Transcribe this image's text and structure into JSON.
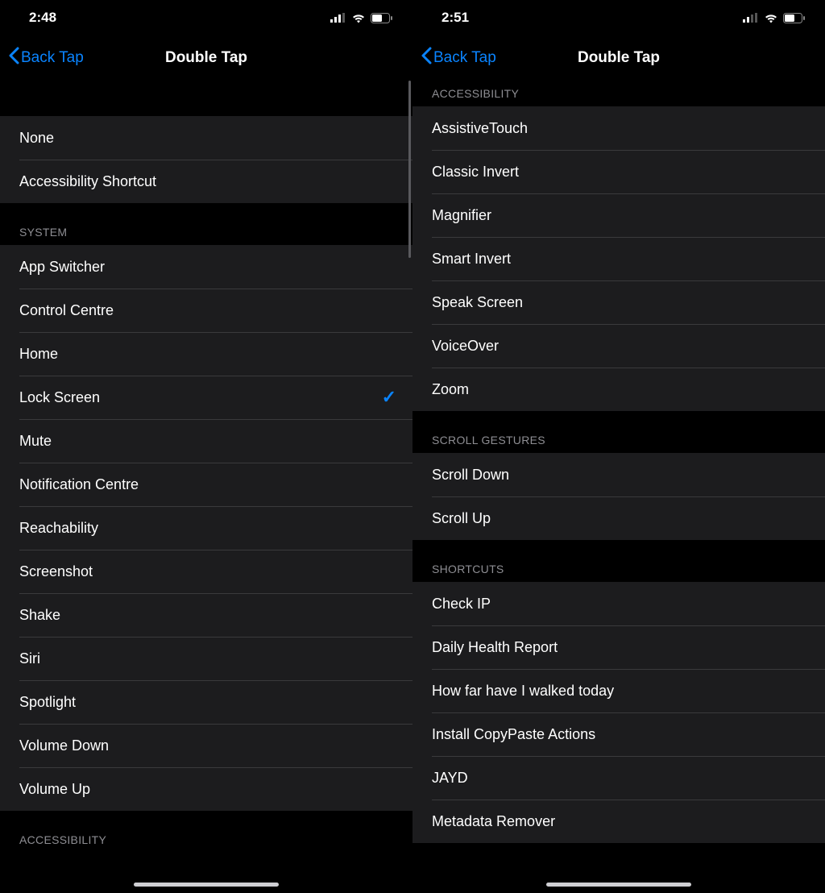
{
  "left": {
    "status": {
      "time": "2:48"
    },
    "nav": {
      "back_label": "Back Tap",
      "title": "Double Tap"
    },
    "top_group": [
      {
        "label": "None",
        "selected": false
      },
      {
        "label": "Accessibility Shortcut",
        "selected": false
      }
    ],
    "sections": [
      {
        "header": "SYSTEM",
        "rows": [
          {
            "label": "App Switcher",
            "selected": false
          },
          {
            "label": "Control Centre",
            "selected": false
          },
          {
            "label": "Home",
            "selected": false
          },
          {
            "label": "Lock Screen",
            "selected": true
          },
          {
            "label": "Mute",
            "selected": false
          },
          {
            "label": "Notification Centre",
            "selected": false
          },
          {
            "label": "Reachability",
            "selected": false
          },
          {
            "label": "Screenshot",
            "selected": false
          },
          {
            "label": "Shake",
            "selected": false
          },
          {
            "label": "Siri",
            "selected": false
          },
          {
            "label": "Spotlight",
            "selected": false
          },
          {
            "label": "Volume Down",
            "selected": false
          },
          {
            "label": "Volume Up",
            "selected": false
          }
        ]
      },
      {
        "header": "ACCESSIBILITY",
        "rows": []
      }
    ]
  },
  "right": {
    "status": {
      "time": "2:51"
    },
    "nav": {
      "back_label": "Back Tap",
      "title": "Double Tap"
    },
    "sections": [
      {
        "header": "ACCESSIBILITY",
        "rows": [
          {
            "label": "AssistiveTouch"
          },
          {
            "label": "Classic Invert"
          },
          {
            "label": "Magnifier"
          },
          {
            "label": "Smart Invert"
          },
          {
            "label": "Speak Screen"
          },
          {
            "label": "VoiceOver"
          },
          {
            "label": "Zoom"
          }
        ]
      },
      {
        "header": "SCROLL GESTURES",
        "rows": [
          {
            "label": "Scroll Down"
          },
          {
            "label": "Scroll Up"
          }
        ]
      },
      {
        "header": "SHORTCUTS",
        "rows": [
          {
            "label": "Check IP"
          },
          {
            "label": "Daily Health Report"
          },
          {
            "label": "How far have I walked today"
          },
          {
            "label": "Install CopyPaste Actions"
          },
          {
            "label": "JAYD"
          },
          {
            "label": "Metadata Remover"
          }
        ]
      }
    ]
  },
  "icons": {
    "chevron_left": "chevron-left-icon",
    "checkmark": "checkmark-icon",
    "signal": "signal-icon",
    "wifi": "wifi-icon",
    "battery": "battery-icon"
  },
  "colors": {
    "accent": "#0a84ff",
    "bg": "#000000",
    "group_bg": "#1c1c1e",
    "separator": "#3a3a3c",
    "secondary_text": "#8e8e93"
  }
}
